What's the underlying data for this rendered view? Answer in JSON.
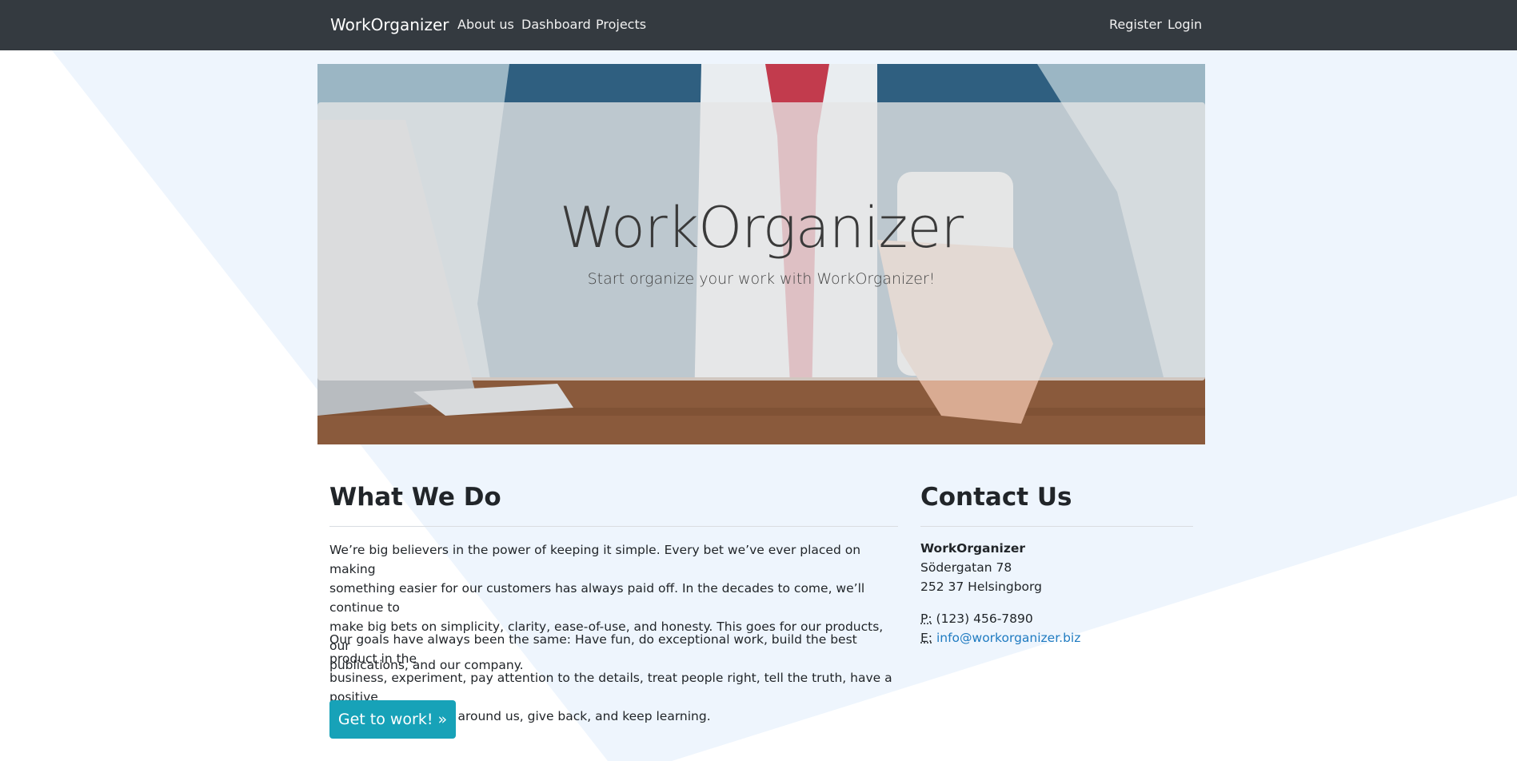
{
  "navbar": {
    "brand": "WorkOrganizer",
    "links": [
      {
        "label": "About us"
      },
      {
        "label": "Dashboard"
      },
      {
        "label": "Projects"
      }
    ],
    "right_links": [
      {
        "label": "Register"
      },
      {
        "label": "Login"
      }
    ]
  },
  "hero": {
    "title": "WorkOrganizer",
    "subtitle": "Start organize your work with WorkOrganizer!"
  },
  "what_we_do": {
    "heading": "What We Do",
    "paragraphs": [
      [
        "We’re big believers in the power of keeping it simple. Every bet we’ve ever placed on making",
        "something easier for our customers has always paid off. In the decades to come, we’ll continue to",
        "make big bets on simplicity, clarity, ease-of-use, and honesty. This goes for our products, our",
        "publications, and our company."
      ],
      [
        "Our goals have always been the same: Have fun, do exceptional work, build the best product in the",
        "business, experiment, pay attention to the details, treat people right, tell the truth, have a positive",
        "impact on the world around us, give back, and keep learning."
      ]
    ],
    "button_label": "Get to work! »"
  },
  "contact": {
    "heading": "Contact Us",
    "company": "WorkOrganizer",
    "street": "Södergatan 78",
    "city": "252 37 Helsingborg",
    "phone_label": "P:",
    "phone": "(123) 456-7890",
    "email_label": "E:",
    "email": "info@workorganizer.biz"
  },
  "colors": {
    "navbar_bg": "#343a40",
    "button_bg": "#17a2b8",
    "link": "#1f7bc1",
    "background_shape": "#eef5fd"
  }
}
